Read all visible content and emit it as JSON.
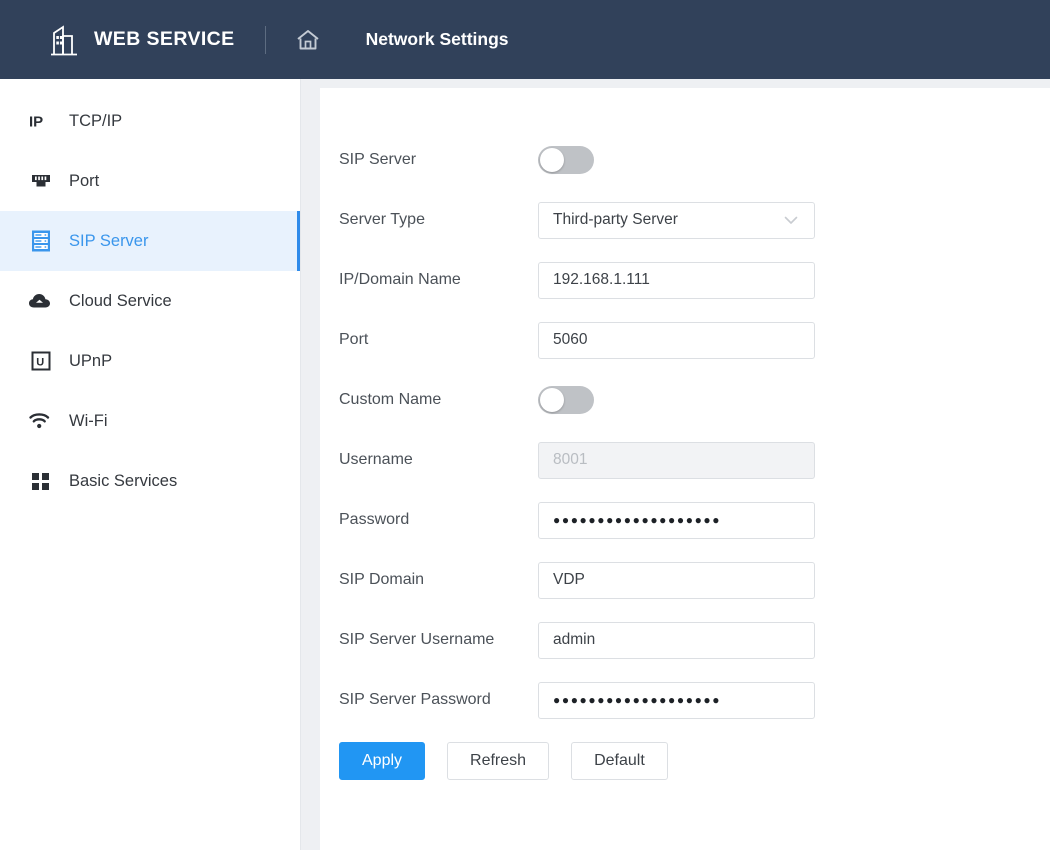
{
  "header": {
    "logo_icon": "building-icon",
    "brand": "WEB SERVICE",
    "home_icon": "home-icon",
    "page_title": "Network Settings"
  },
  "sidebar": {
    "items": [
      {
        "label": "TCP/IP",
        "icon": "ip-icon",
        "active": false
      },
      {
        "label": "Port",
        "icon": "ethernet-port-icon",
        "active": false
      },
      {
        "label": "SIP Server",
        "icon": "server-rack-icon",
        "active": true
      },
      {
        "label": "Cloud Service",
        "icon": "cloud-icon",
        "active": false
      },
      {
        "label": "UPnP",
        "icon": "upnp-icon",
        "active": false
      },
      {
        "label": "Wi-Fi",
        "icon": "wifi-icon",
        "active": false
      },
      {
        "label": "Basic Services",
        "icon": "grid-icon",
        "active": false
      }
    ]
  },
  "form": {
    "sip_server": {
      "label": "SIP Server",
      "control": "toggle",
      "value": "off"
    },
    "server_type": {
      "label": "Server Type",
      "control": "select",
      "value": "Third-party Server",
      "chevron": "chevron-down-icon"
    },
    "ip_domain": {
      "label": "IP/Domain Name",
      "control": "text",
      "value": "192.168.1.111",
      "placeholder": ""
    },
    "port": {
      "label": "Port",
      "control": "text",
      "value": "5060",
      "placeholder": ""
    },
    "custom_name": {
      "label": "Custom Name",
      "control": "toggle",
      "value": "off"
    },
    "username": {
      "label": "Username",
      "control": "text",
      "value": "",
      "placeholder": "8001",
      "disabled": true
    },
    "password": {
      "label": "Password",
      "control": "password",
      "value": "●●●●●●●●●●●●●●●●●●●"
    },
    "sip_domain": {
      "label": "SIP Domain",
      "control": "text",
      "value": "VDP",
      "placeholder": ""
    },
    "sip_server_username": {
      "label": "SIP Server Username",
      "control": "text",
      "value": "admin",
      "placeholder": ""
    },
    "sip_server_password": {
      "label": "SIP Server Password",
      "control": "password",
      "value": "●●●●●●●●●●●●●●●●●●●"
    },
    "buttons": {
      "apply": "Apply",
      "refresh": "Refresh",
      "default": "Default"
    }
  },
  "colors": {
    "header_bg": "#31415a",
    "accent": "#2196f3",
    "active_nav_bg": "#e8f2fd",
    "active_nav_text": "#3a96ec",
    "content_bg": "#eef0f3",
    "toggle_off": "#bfc2c6"
  }
}
